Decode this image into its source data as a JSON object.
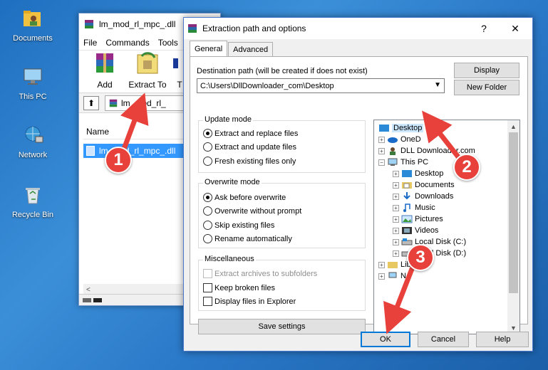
{
  "desktop": {
    "icons": [
      {
        "label": "Documents",
        "icon": "folder-user-icon"
      },
      {
        "label": "This PC",
        "icon": "computer-icon"
      },
      {
        "label": "Network",
        "icon": "network-icon"
      },
      {
        "label": "Recycle Bin",
        "icon": "recycle-bin-icon"
      }
    ]
  },
  "winrar": {
    "title": "lm_mod_rl_mpc_.dll",
    "menu": [
      "File",
      "Commands",
      "Tools"
    ],
    "toolbar": {
      "add": "Add",
      "extract_to": "Extract To",
      "more": "T"
    },
    "address": "lm_mod_rl_",
    "column_name": "Name",
    "selected_file": "lm_mod_rl_mpc_.dll",
    "scroll_left": "<"
  },
  "dialog": {
    "title": "Extraction path and options",
    "help_btn": "?",
    "close_btn": "✕",
    "tabs": [
      "General",
      "Advanced"
    ],
    "dest_label": "Destination path (will be created if does not exist)",
    "dest_value": "C:\\Users\\DllDownloader_com\\Desktop",
    "display_btn": "Display",
    "new_folder_btn": "New Folder",
    "update_mode": {
      "title": "Update mode",
      "options": [
        "Extract and replace files",
        "Extract and update files",
        "Fresh existing files only"
      ],
      "selected": 0
    },
    "overwrite_mode": {
      "title": "Overwrite mode",
      "options": [
        "Ask before overwrite",
        "Overwrite without prompt",
        "Skip existing files",
        "Rename automatically"
      ],
      "selected": 0
    },
    "misc": {
      "title": "Miscellaneous",
      "options": [
        "Extract archives to subfolders",
        "Keep broken files",
        "Display files in Explorer"
      ]
    },
    "save_settings": "Save settings",
    "tree": [
      {
        "label": "Desktop",
        "selected": true
      },
      {
        "label": "OneD"
      },
      {
        "label": "DLL Downloader.com"
      },
      {
        "label": "This PC"
      },
      {
        "label": "Desktop"
      },
      {
        "label": "Documents"
      },
      {
        "label": "Downloads"
      },
      {
        "label": "Music"
      },
      {
        "label": "Pictures"
      },
      {
        "label": "Videos"
      },
      {
        "label": "Local Disk (C:)"
      },
      {
        "label": "Local Disk (D:)"
      },
      {
        "label": "Libr"
      },
      {
        "label": "N"
      }
    ],
    "ok_btn": "OK",
    "cancel_btn": "Cancel",
    "help_footer_btn": "Help"
  },
  "annotations": [
    "1",
    "2",
    "3"
  ],
  "accent_color": "#e8413b"
}
